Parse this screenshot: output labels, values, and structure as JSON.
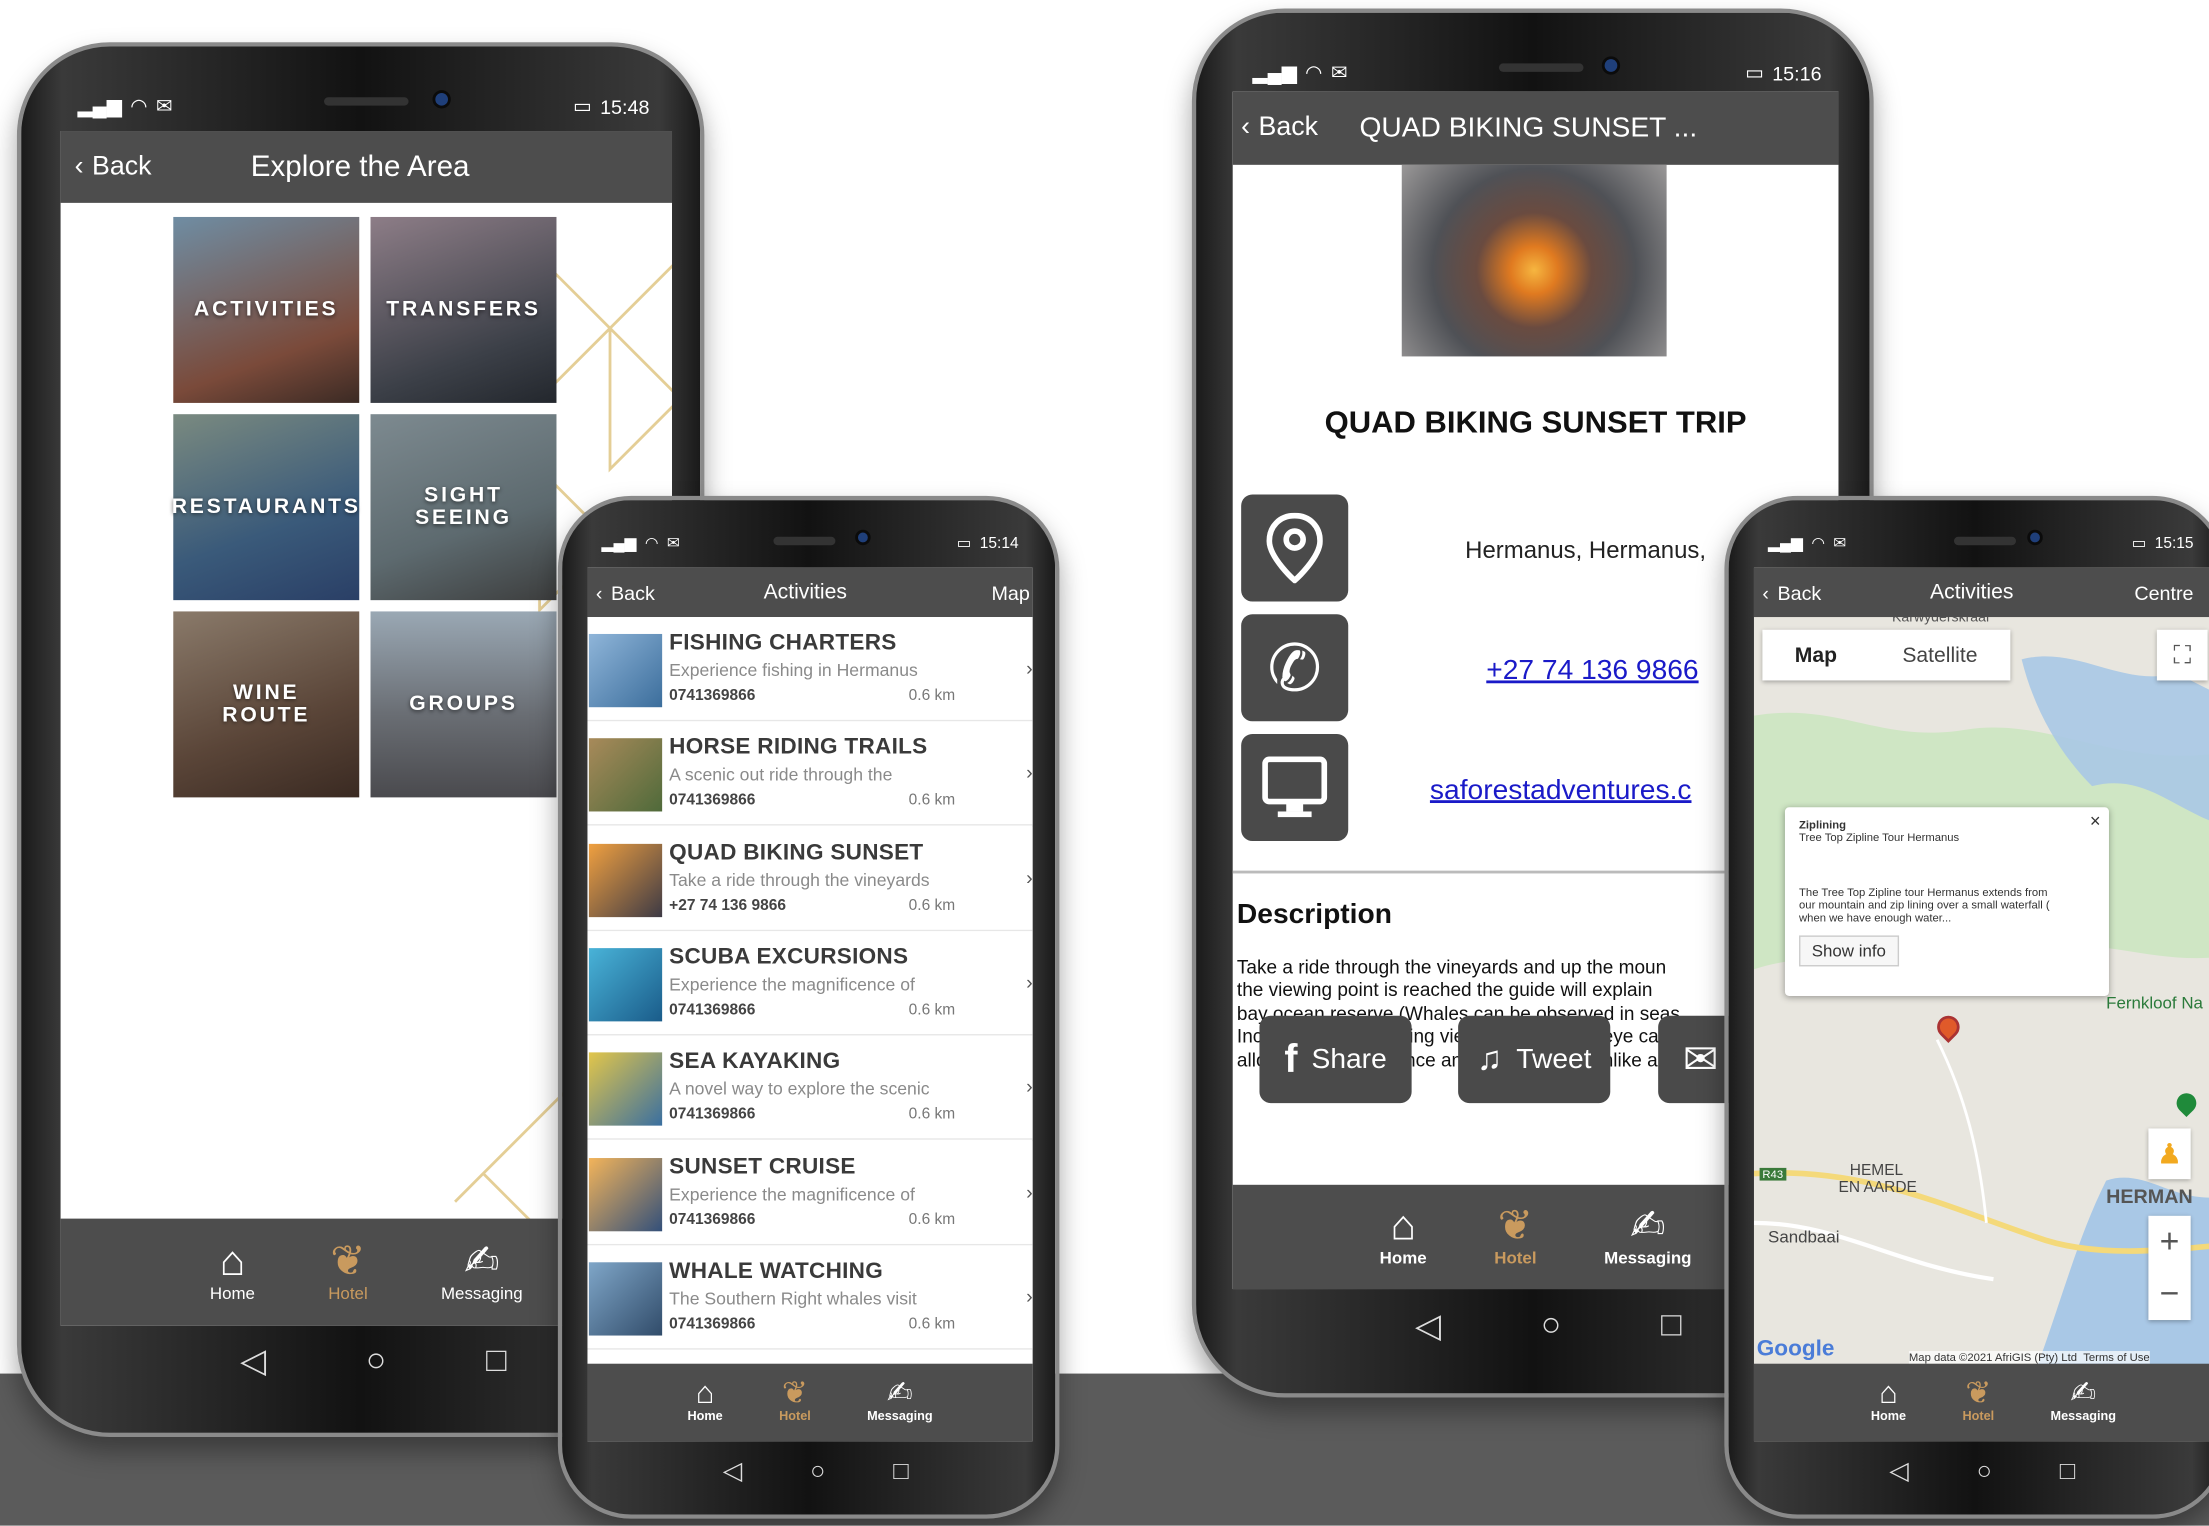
{
  "phone1": {
    "status": {
      "time": "15:48"
    },
    "header": {
      "back": "Back",
      "title": "Explore the Area"
    },
    "tiles": [
      "ACTIVITIES",
      "TRANSFERS",
      "RESTAURANTS",
      "SIGHT SEEING",
      "WINE ROUTE",
      "GROUPS"
    ]
  },
  "phone2": {
    "status": {
      "time": "15:14"
    },
    "header": {
      "back": "Back",
      "title": "Activities",
      "right": "Map"
    },
    "items": [
      {
        "title": "FISHING CHARTERS",
        "desc": "Experience fishing in Hermanus",
        "phone": "0741369866",
        "dist": "0.6 km"
      },
      {
        "title": "HORSE RIDING TRAILS",
        "desc": "A scenic out ride through the",
        "phone": "0741369866",
        "dist": "0.6 km"
      },
      {
        "title": "QUAD BIKING SUNSET",
        "desc": "Take a ride through the vineyards",
        "phone": "+27 74 136 9866",
        "dist": "0.6 km"
      },
      {
        "title": "SCUBA EXCURSIONS",
        "desc": "Experience the magnificence of",
        "phone": "0741369866",
        "dist": "0.6 km"
      },
      {
        "title": "SEA KAYAKING",
        "desc": "A novel way to explore the scenic",
        "phone": "0741369866",
        "dist": "0.6 km"
      },
      {
        "title": "SUNSET CRUISE",
        "desc": "Experience the magnificence of",
        "phone": "0741369866",
        "dist": "0.6 km"
      },
      {
        "title": "WHALE WATCHING",
        "desc": "The Southern Right whales visit",
        "phone": "0741369866",
        "dist": "0.6 km"
      }
    ]
  },
  "phone3": {
    "status": {
      "time": "15:16"
    },
    "header": {
      "back": "Back",
      "title": "QUAD BIKING SUNSET ..."
    },
    "detail_title": "QUAD BIKING SUNSET TRIP",
    "location": "Hermanus, Hermanus,",
    "phone": "+27 74 136 9866",
    "website": "saforestadventures.c",
    "desc_heading": "Description",
    "desc_lines": [
      "Take a ride through the vineyards and up the moun",
      "the viewing point is reached the guide will explain",
      "bay ocean reserve (Whales can be observed in seas",
      "Incredibly breath-taking views as far as the eye can",
      "allow you to experience an African sunset unlike an"
    ],
    "share": "Share",
    "tweet": "Tweet"
  },
  "phone4": {
    "status": {
      "time": "15:15"
    },
    "header": {
      "back": "Back",
      "title": "Activities",
      "right": "Centre"
    },
    "map_tab": "Map",
    "satellite_tab": "Satellite",
    "popup": {
      "category": "Ziplining",
      "name": "Tree Top Zipline Tour Hermanus",
      "text_lines": [
        "The Tree Top Zipline tour Hermanus extends from",
        "our mountain and zip lining over a small waterfall (",
        "when we have enough water..."
      ],
      "button": "Show info"
    },
    "labels": {
      "top": "Karwyderskraal",
      "fernkloof": "Fernkloof Na",
      "hemel1": "HEMEL",
      "hemel2": "EN AARDE",
      "herman": "HERMAN",
      "sandbaai": "Sandbaai",
      "r43": "R43",
      "google": "Google",
      "attrib": "Map data ©2021 AfriGIS (Pty) Ltd",
      "terms": "Terms of Use"
    }
  },
  "tabbar": {
    "home": "Home",
    "hotel": "Hotel",
    "messaging": "Messaging"
  },
  "colors": {
    "header": "#4d4d4d",
    "accent": "#c99a5e",
    "link": "#1a1ac8"
  }
}
